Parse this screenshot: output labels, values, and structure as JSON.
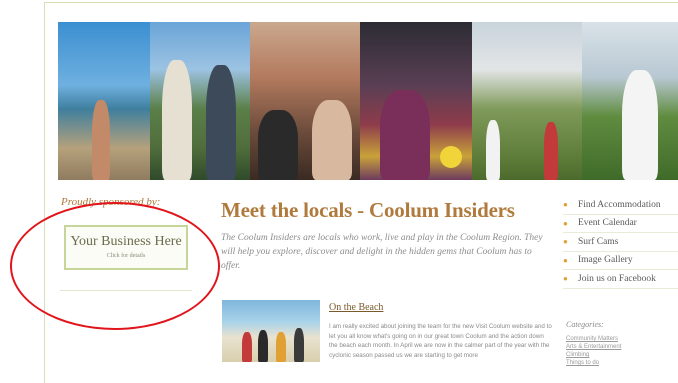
{
  "sponsor": {
    "label": "Proudly sponsored by:",
    "box_title": "Your Business Here",
    "box_sub": "Click for details"
  },
  "main": {
    "heading": "Meet the locals - Coolum Insiders",
    "intro": "The Coolum Insiders are locals who work, live and play in the Coolum Region. They will help you explore, discover and delight in the hidden gems that Coolum has to offer."
  },
  "article": {
    "title": "On the Beach",
    "body": "I am really excited about joining the team for the new Visit Coolum website and to let you all know what's going on in our great town Coolum and the action down the beach each month. In April we are now in the calmer part of the year with the cyclonic season passed us we are starting to get more"
  },
  "nav": {
    "items": [
      {
        "label": "Find Accommodation"
      },
      {
        "label": "Event Calendar"
      },
      {
        "label": "Surf Cams"
      },
      {
        "label": "Image Gallery"
      },
      {
        "label": "Join us on Facebook"
      }
    ]
  },
  "categories": {
    "heading": "Categories:",
    "items": [
      {
        "label": "Community Matters"
      },
      {
        "label": "Arts & Entertainment"
      },
      {
        "label": "Climbing"
      },
      {
        "label": "Things to do"
      }
    ]
  },
  "colors": {
    "accent": "#b07a3d",
    "annotation": "#e1151b",
    "bullet": "#e0a033"
  }
}
